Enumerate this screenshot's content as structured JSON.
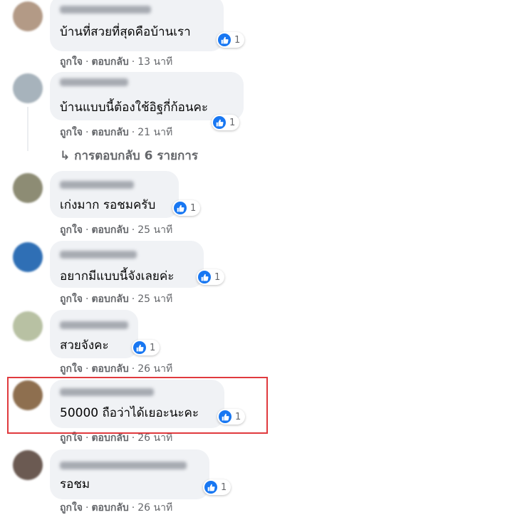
{
  "like_count_label": "1",
  "actions": {
    "like": "ถูกใจ",
    "reply": "ตอบกลับ",
    "separator": "·"
  },
  "view_replies": "↳ การตอบกลับ 6 รายการ",
  "colors": {
    "like_blue": "#1877f2",
    "bubble": "#f0f2f5",
    "highlight": "#e03a3e",
    "meta": "#65676b"
  },
  "comments": [
    {
      "text": "บ้านที่สวยที่สุดคือบ้านเรา",
      "time": "13 นาที",
      "likes": "1"
    },
    {
      "text": "บ้านแบบนี้ต้องใช้อิฐกี่ก้อนคะ",
      "time": "21 นาที",
      "likes": "1"
    },
    {
      "text": "เก่งมาก รอชมครับ",
      "time": "25 นาที",
      "likes": "1"
    },
    {
      "text": "อยากมีแบบนี้จังเลยค่ะ",
      "time": "25 นาที",
      "likes": "1"
    },
    {
      "text": "สวยจังคะ",
      "time": "26 นาที",
      "likes": "1"
    },
    {
      "text": "50000 ถือว่าได้เยอะนะคะ",
      "time": "26 นาที",
      "likes": "1"
    },
    {
      "text": "รอชม",
      "time": "26 นาที",
      "likes": "1"
    }
  ]
}
